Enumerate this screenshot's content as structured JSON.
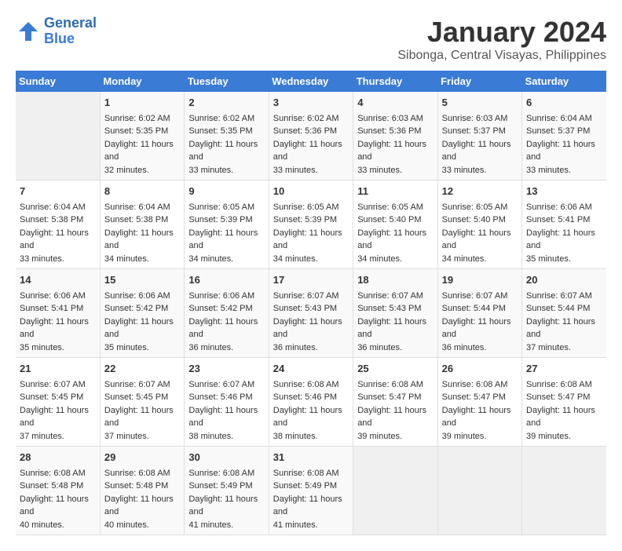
{
  "logo": {
    "line1": "General",
    "line2": "Blue"
  },
  "title": "January 2024",
  "location": "Sibonga, Central Visayas, Philippines",
  "days_of_week": [
    "Sunday",
    "Monday",
    "Tuesday",
    "Wednesday",
    "Thursday",
    "Friday",
    "Saturday"
  ],
  "weeks": [
    [
      {
        "day": "",
        "sunrise": "",
        "sunset": "",
        "daylight": ""
      },
      {
        "day": "1",
        "sunrise": "Sunrise: 6:02 AM",
        "sunset": "Sunset: 5:35 PM",
        "daylight": "Daylight: 11 hours and 32 minutes."
      },
      {
        "day": "2",
        "sunrise": "Sunrise: 6:02 AM",
        "sunset": "Sunset: 5:35 PM",
        "daylight": "Daylight: 11 hours and 33 minutes."
      },
      {
        "day": "3",
        "sunrise": "Sunrise: 6:02 AM",
        "sunset": "Sunset: 5:36 PM",
        "daylight": "Daylight: 11 hours and 33 minutes."
      },
      {
        "day": "4",
        "sunrise": "Sunrise: 6:03 AM",
        "sunset": "Sunset: 5:36 PM",
        "daylight": "Daylight: 11 hours and 33 minutes."
      },
      {
        "day": "5",
        "sunrise": "Sunrise: 6:03 AM",
        "sunset": "Sunset: 5:37 PM",
        "daylight": "Daylight: 11 hours and 33 minutes."
      },
      {
        "day": "6",
        "sunrise": "Sunrise: 6:04 AM",
        "sunset": "Sunset: 5:37 PM",
        "daylight": "Daylight: 11 hours and 33 minutes."
      }
    ],
    [
      {
        "day": "7",
        "sunrise": "Sunrise: 6:04 AM",
        "sunset": "Sunset: 5:38 PM",
        "daylight": "Daylight: 11 hours and 33 minutes."
      },
      {
        "day": "8",
        "sunrise": "Sunrise: 6:04 AM",
        "sunset": "Sunset: 5:38 PM",
        "daylight": "Daylight: 11 hours and 34 minutes."
      },
      {
        "day": "9",
        "sunrise": "Sunrise: 6:05 AM",
        "sunset": "Sunset: 5:39 PM",
        "daylight": "Daylight: 11 hours and 34 minutes."
      },
      {
        "day": "10",
        "sunrise": "Sunrise: 6:05 AM",
        "sunset": "Sunset: 5:39 PM",
        "daylight": "Daylight: 11 hours and 34 minutes."
      },
      {
        "day": "11",
        "sunrise": "Sunrise: 6:05 AM",
        "sunset": "Sunset: 5:40 PM",
        "daylight": "Daylight: 11 hours and 34 minutes."
      },
      {
        "day": "12",
        "sunrise": "Sunrise: 6:05 AM",
        "sunset": "Sunset: 5:40 PM",
        "daylight": "Daylight: 11 hours and 34 minutes."
      },
      {
        "day": "13",
        "sunrise": "Sunrise: 6:06 AM",
        "sunset": "Sunset: 5:41 PM",
        "daylight": "Daylight: 11 hours and 35 minutes."
      }
    ],
    [
      {
        "day": "14",
        "sunrise": "Sunrise: 6:06 AM",
        "sunset": "Sunset: 5:41 PM",
        "daylight": "Daylight: 11 hours and 35 minutes."
      },
      {
        "day": "15",
        "sunrise": "Sunrise: 6:06 AM",
        "sunset": "Sunset: 5:42 PM",
        "daylight": "Daylight: 11 hours and 35 minutes."
      },
      {
        "day": "16",
        "sunrise": "Sunrise: 6:06 AM",
        "sunset": "Sunset: 5:42 PM",
        "daylight": "Daylight: 11 hours and 36 minutes."
      },
      {
        "day": "17",
        "sunrise": "Sunrise: 6:07 AM",
        "sunset": "Sunset: 5:43 PM",
        "daylight": "Daylight: 11 hours and 36 minutes."
      },
      {
        "day": "18",
        "sunrise": "Sunrise: 6:07 AM",
        "sunset": "Sunset: 5:43 PM",
        "daylight": "Daylight: 11 hours and 36 minutes."
      },
      {
        "day": "19",
        "sunrise": "Sunrise: 6:07 AM",
        "sunset": "Sunset: 5:44 PM",
        "daylight": "Daylight: 11 hours and 36 minutes."
      },
      {
        "day": "20",
        "sunrise": "Sunrise: 6:07 AM",
        "sunset": "Sunset: 5:44 PM",
        "daylight": "Daylight: 11 hours and 37 minutes."
      }
    ],
    [
      {
        "day": "21",
        "sunrise": "Sunrise: 6:07 AM",
        "sunset": "Sunset: 5:45 PM",
        "daylight": "Daylight: 11 hours and 37 minutes."
      },
      {
        "day": "22",
        "sunrise": "Sunrise: 6:07 AM",
        "sunset": "Sunset: 5:45 PM",
        "daylight": "Daylight: 11 hours and 37 minutes."
      },
      {
        "day": "23",
        "sunrise": "Sunrise: 6:07 AM",
        "sunset": "Sunset: 5:46 PM",
        "daylight": "Daylight: 11 hours and 38 minutes."
      },
      {
        "day": "24",
        "sunrise": "Sunrise: 6:08 AM",
        "sunset": "Sunset: 5:46 PM",
        "daylight": "Daylight: 11 hours and 38 minutes."
      },
      {
        "day": "25",
        "sunrise": "Sunrise: 6:08 AM",
        "sunset": "Sunset: 5:47 PM",
        "daylight": "Daylight: 11 hours and 39 minutes."
      },
      {
        "day": "26",
        "sunrise": "Sunrise: 6:08 AM",
        "sunset": "Sunset: 5:47 PM",
        "daylight": "Daylight: 11 hours and 39 minutes."
      },
      {
        "day": "27",
        "sunrise": "Sunrise: 6:08 AM",
        "sunset": "Sunset: 5:47 PM",
        "daylight": "Daylight: 11 hours and 39 minutes."
      }
    ],
    [
      {
        "day": "28",
        "sunrise": "Sunrise: 6:08 AM",
        "sunset": "Sunset: 5:48 PM",
        "daylight": "Daylight: 11 hours and 40 minutes."
      },
      {
        "day": "29",
        "sunrise": "Sunrise: 6:08 AM",
        "sunset": "Sunset: 5:48 PM",
        "daylight": "Daylight: 11 hours and 40 minutes."
      },
      {
        "day": "30",
        "sunrise": "Sunrise: 6:08 AM",
        "sunset": "Sunset: 5:49 PM",
        "daylight": "Daylight: 11 hours and 41 minutes."
      },
      {
        "day": "31",
        "sunrise": "Sunrise: 6:08 AM",
        "sunset": "Sunset: 5:49 PM",
        "daylight": "Daylight: 11 hours and 41 minutes."
      },
      {
        "day": "",
        "sunrise": "",
        "sunset": "",
        "daylight": ""
      },
      {
        "day": "",
        "sunrise": "",
        "sunset": "",
        "daylight": ""
      },
      {
        "day": "",
        "sunrise": "",
        "sunset": "",
        "daylight": ""
      }
    ]
  ]
}
